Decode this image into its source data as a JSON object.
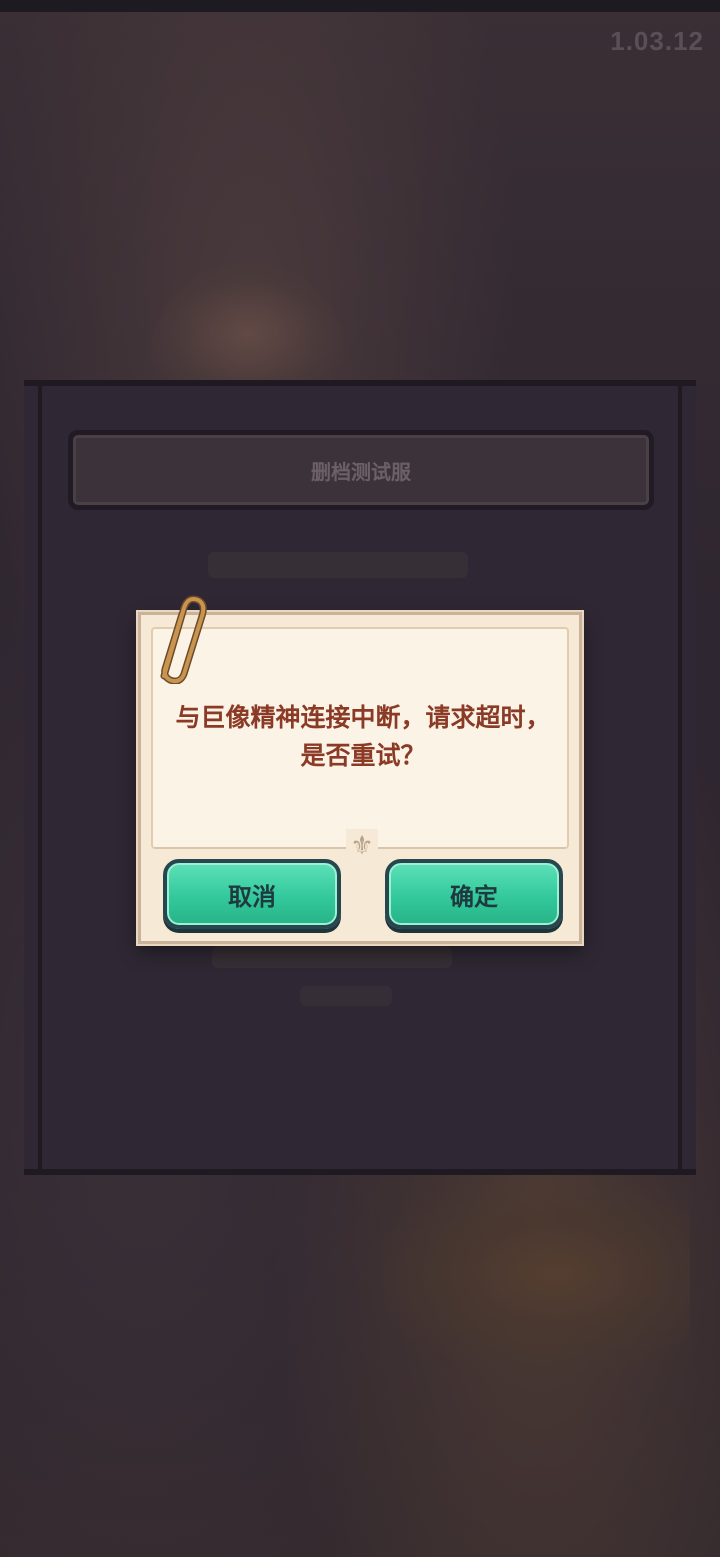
{
  "app": {
    "version": "1.03.12"
  },
  "server": {
    "name": "删档测试服"
  },
  "dialog": {
    "message": "与巨像精神连接中断，请求超时，是否重试？",
    "cancel_label": "取消",
    "confirm_label": "确定"
  },
  "colors": {
    "button_fill": "#33c99c",
    "message_text": "#8b3a26",
    "dialog_paper": "#f6ead6",
    "overlay_bg": "#2b2430"
  },
  "icons": {
    "paperclip": "paperclip-icon",
    "ornament": "fleur-de-lis-icon"
  }
}
